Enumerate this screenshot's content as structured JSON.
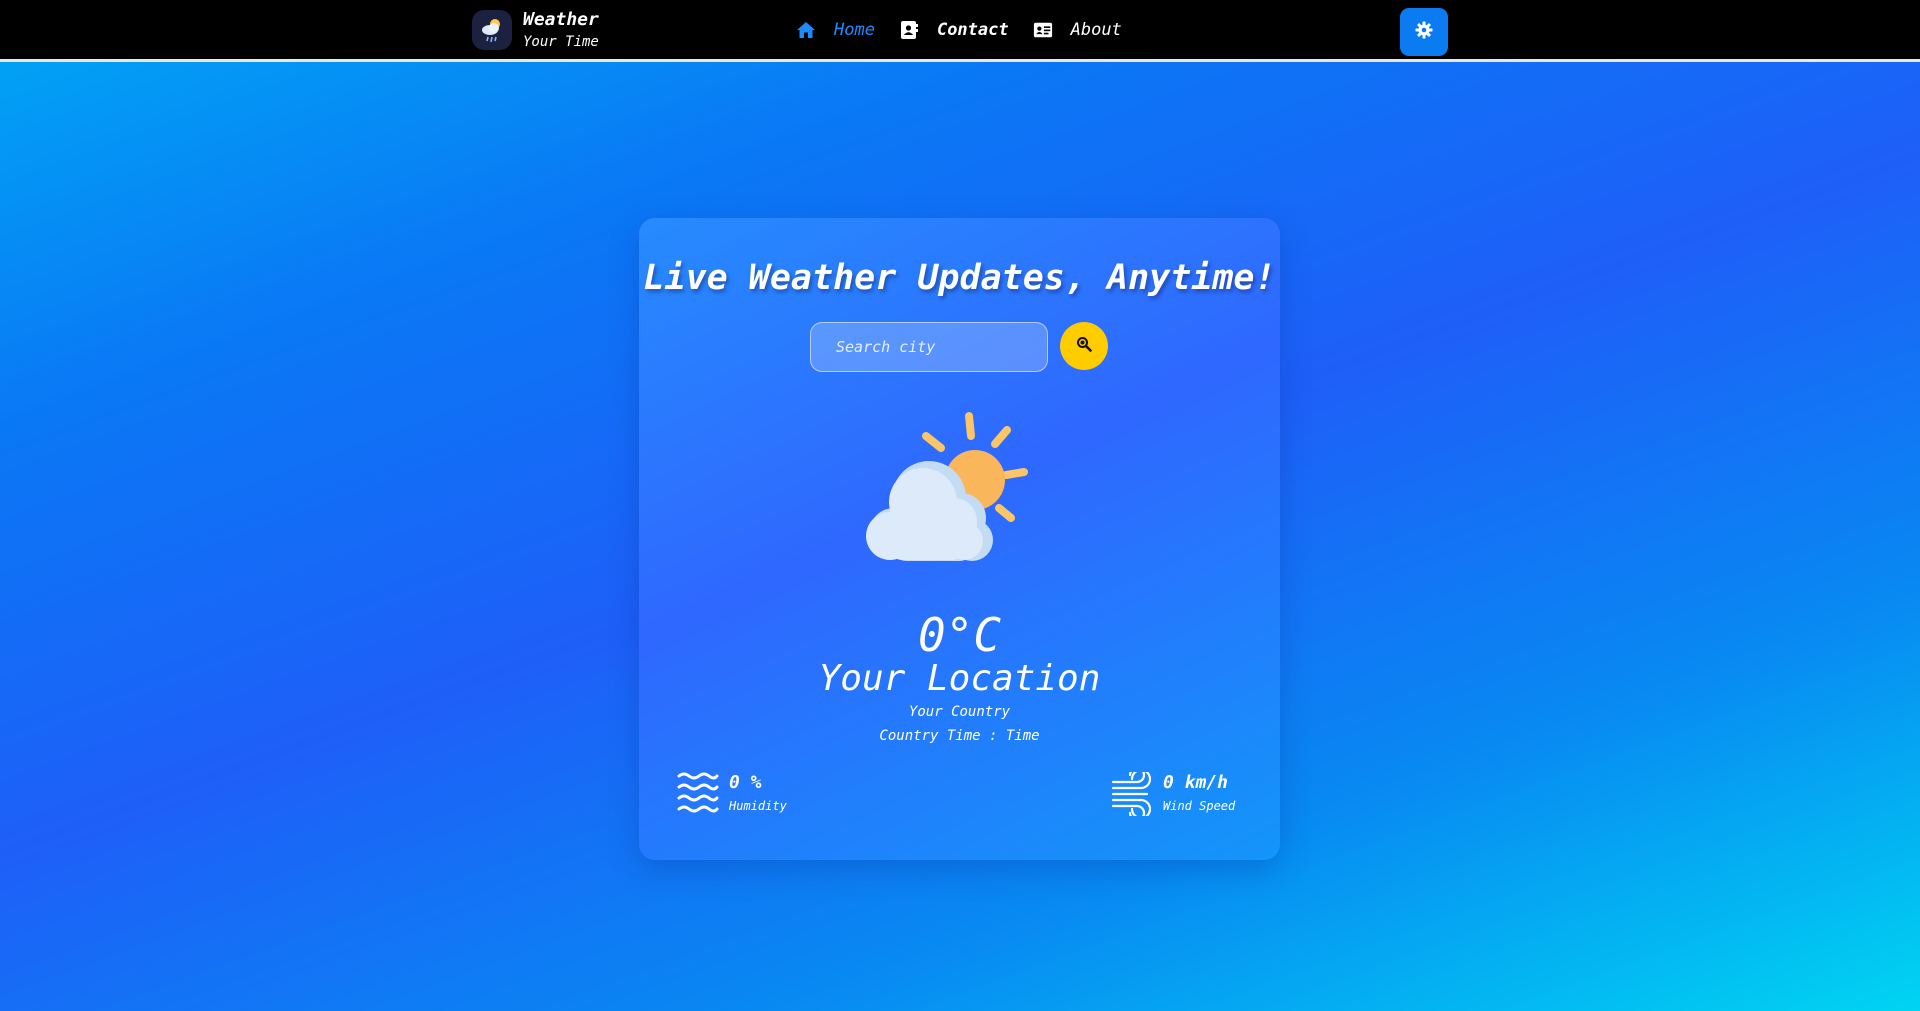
{
  "brand": {
    "title": "Weather",
    "subtitle": "Your Time",
    "icon": "weather-logo-icon"
  },
  "nav": {
    "items": [
      {
        "label": "Home",
        "icon": "home-icon",
        "active": true
      },
      {
        "label": "Contact",
        "icon": "contact-book-icon",
        "active": false
      },
      {
        "label": "About",
        "icon": "id-card-icon",
        "active": false
      }
    ]
  },
  "settings": {
    "icon": "gear-icon",
    "color": "#0a7bf0"
  },
  "main": {
    "headline": "Live Weather Updates, Anytime!",
    "search": {
      "placeholder": "Search city",
      "value": "",
      "button_icon": "search-icon",
      "button_color": "#ffcc00"
    },
    "weather_icon": "partly-cloudy-icon",
    "temperature": "0°C",
    "location": "Your Location",
    "country": "Your Country",
    "country_time": "Country Time : Time",
    "humidity": {
      "value": "0 %",
      "label": "Humidity",
      "icon": "waves-icon"
    },
    "wind": {
      "value": "0 km/h",
      "label": "Wind Speed",
      "icon": "wind-icon"
    }
  },
  "colors": {
    "nav_active": "#1d8bff",
    "navbar_bg": "#000000"
  }
}
